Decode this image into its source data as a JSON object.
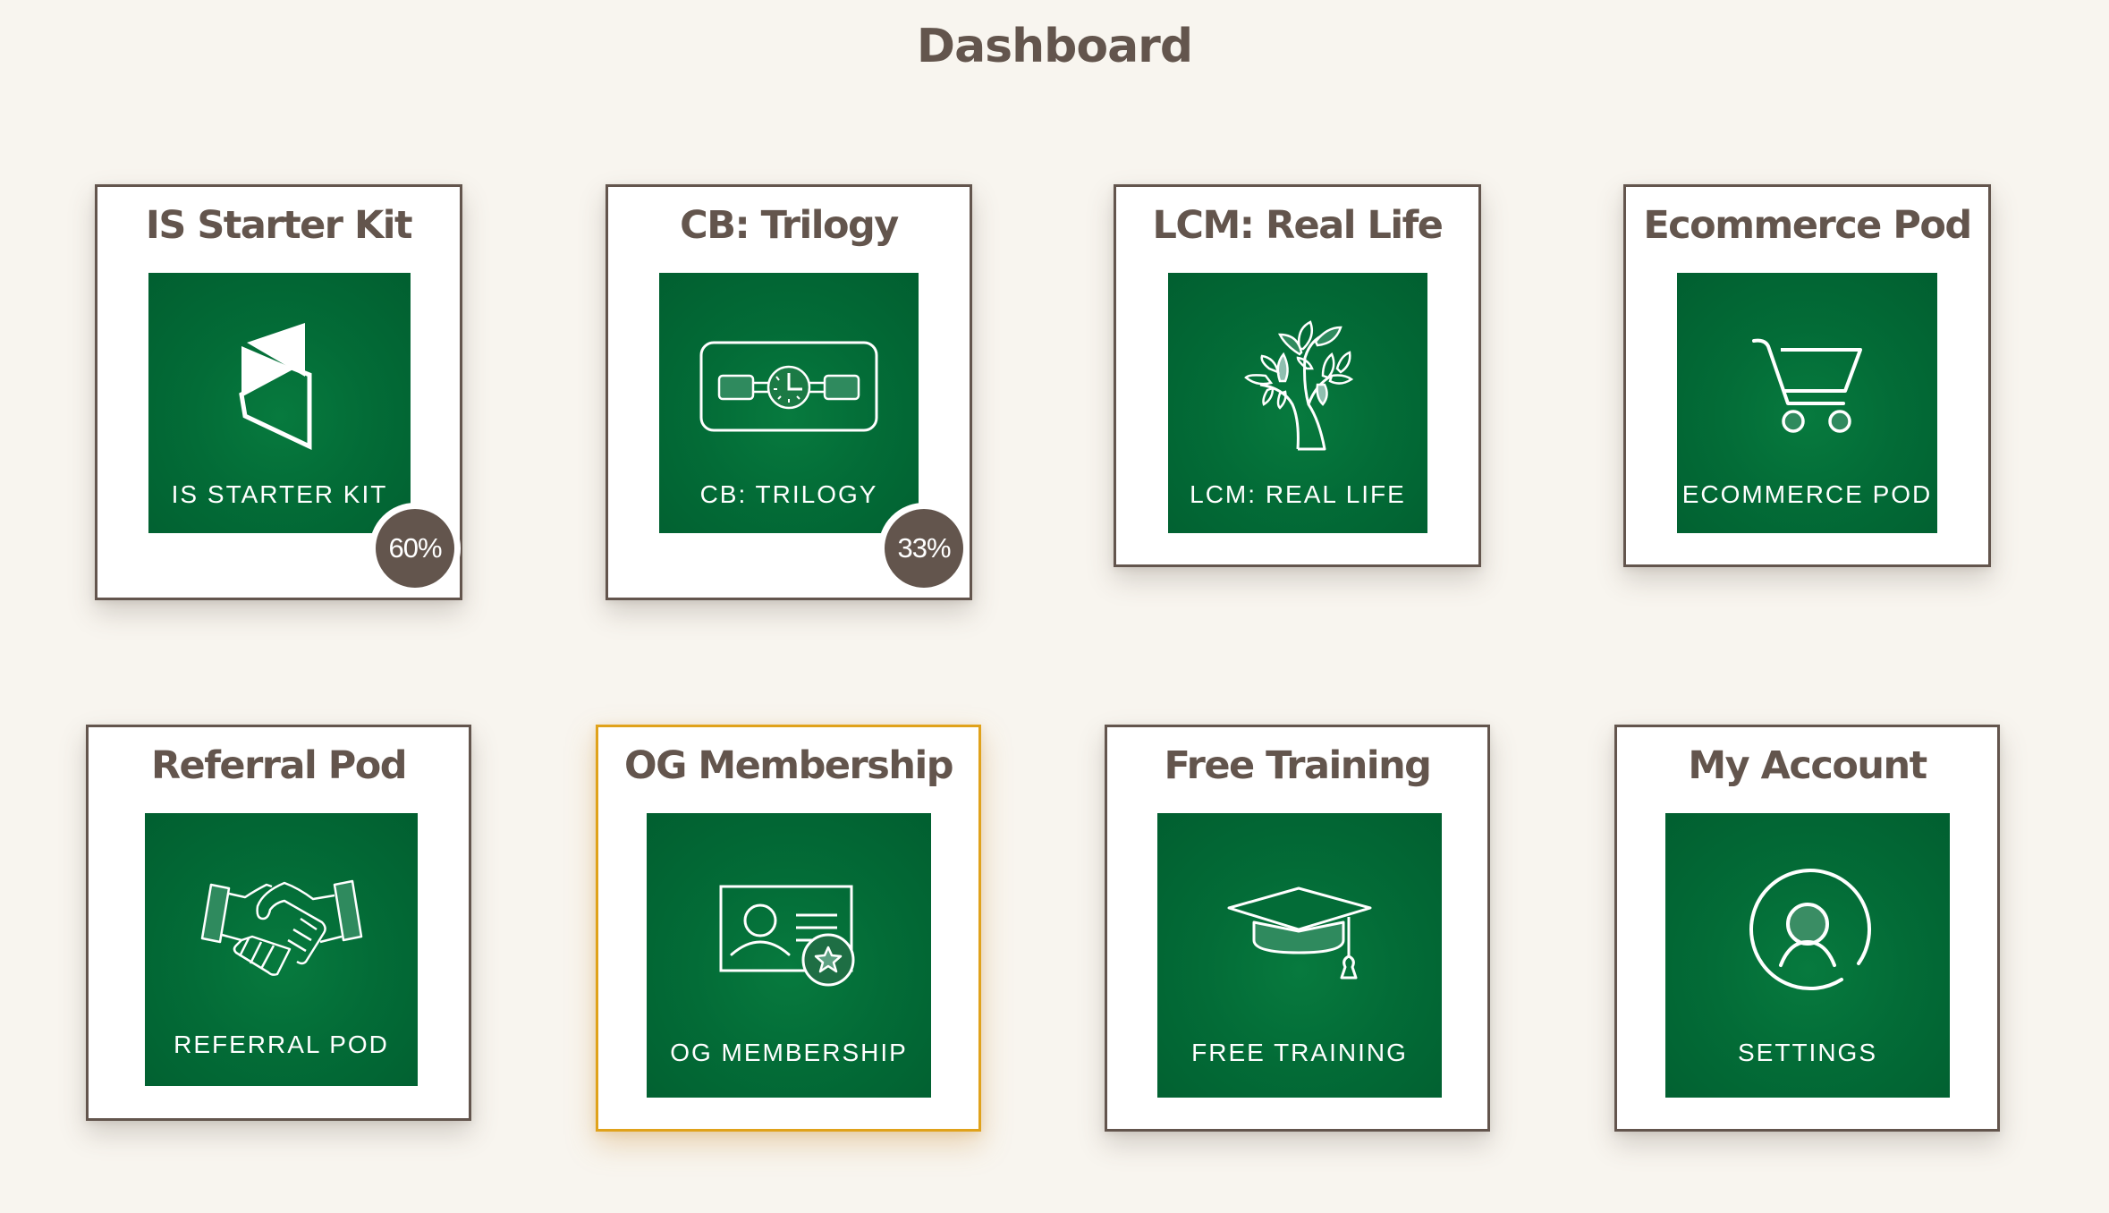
{
  "page": {
    "title": "Dashboard",
    "background_color": "#f8f5ef",
    "accent_text_color": "#63554d",
    "tile_color": "#036c37",
    "highlight_border_color": "#e0a21b"
  },
  "cards": [
    {
      "title": "IS Starter Kit",
      "tile_label": "IS STARTER KIT",
      "icon": "starter-kit-logo-icon",
      "progress_label": "60%",
      "progress_percent": 60,
      "highlighted": false
    },
    {
      "title": "CB: Trilogy",
      "tile_label": "CB: TRILOGY",
      "icon": "clock-timeline-icon",
      "progress_label": "33%",
      "progress_percent": 33,
      "highlighted": false
    },
    {
      "title": "LCM: Real Life",
      "tile_label": "LCM: REAL LIFE",
      "icon": "tree-icon",
      "highlighted": false
    },
    {
      "title": "Ecommerce Pod",
      "tile_label": "ECOMMERCE POD",
      "icon": "shopping-cart-icon",
      "highlighted": false
    },
    {
      "title": "Referral Pod",
      "tile_label": "REFERRAL POD",
      "icon": "handshake-icon",
      "highlighted": false
    },
    {
      "title": "OG Membership",
      "tile_label": "OG MEMBERSHIP",
      "icon": "membership-card-icon",
      "highlighted": true
    },
    {
      "title": "Free Training",
      "tile_label": "FREE TRAINING",
      "icon": "graduation-cap-icon",
      "highlighted": false
    },
    {
      "title": "My Account",
      "tile_label": "SETTINGS",
      "icon": "user-circle-icon",
      "highlighted": false
    }
  ]
}
